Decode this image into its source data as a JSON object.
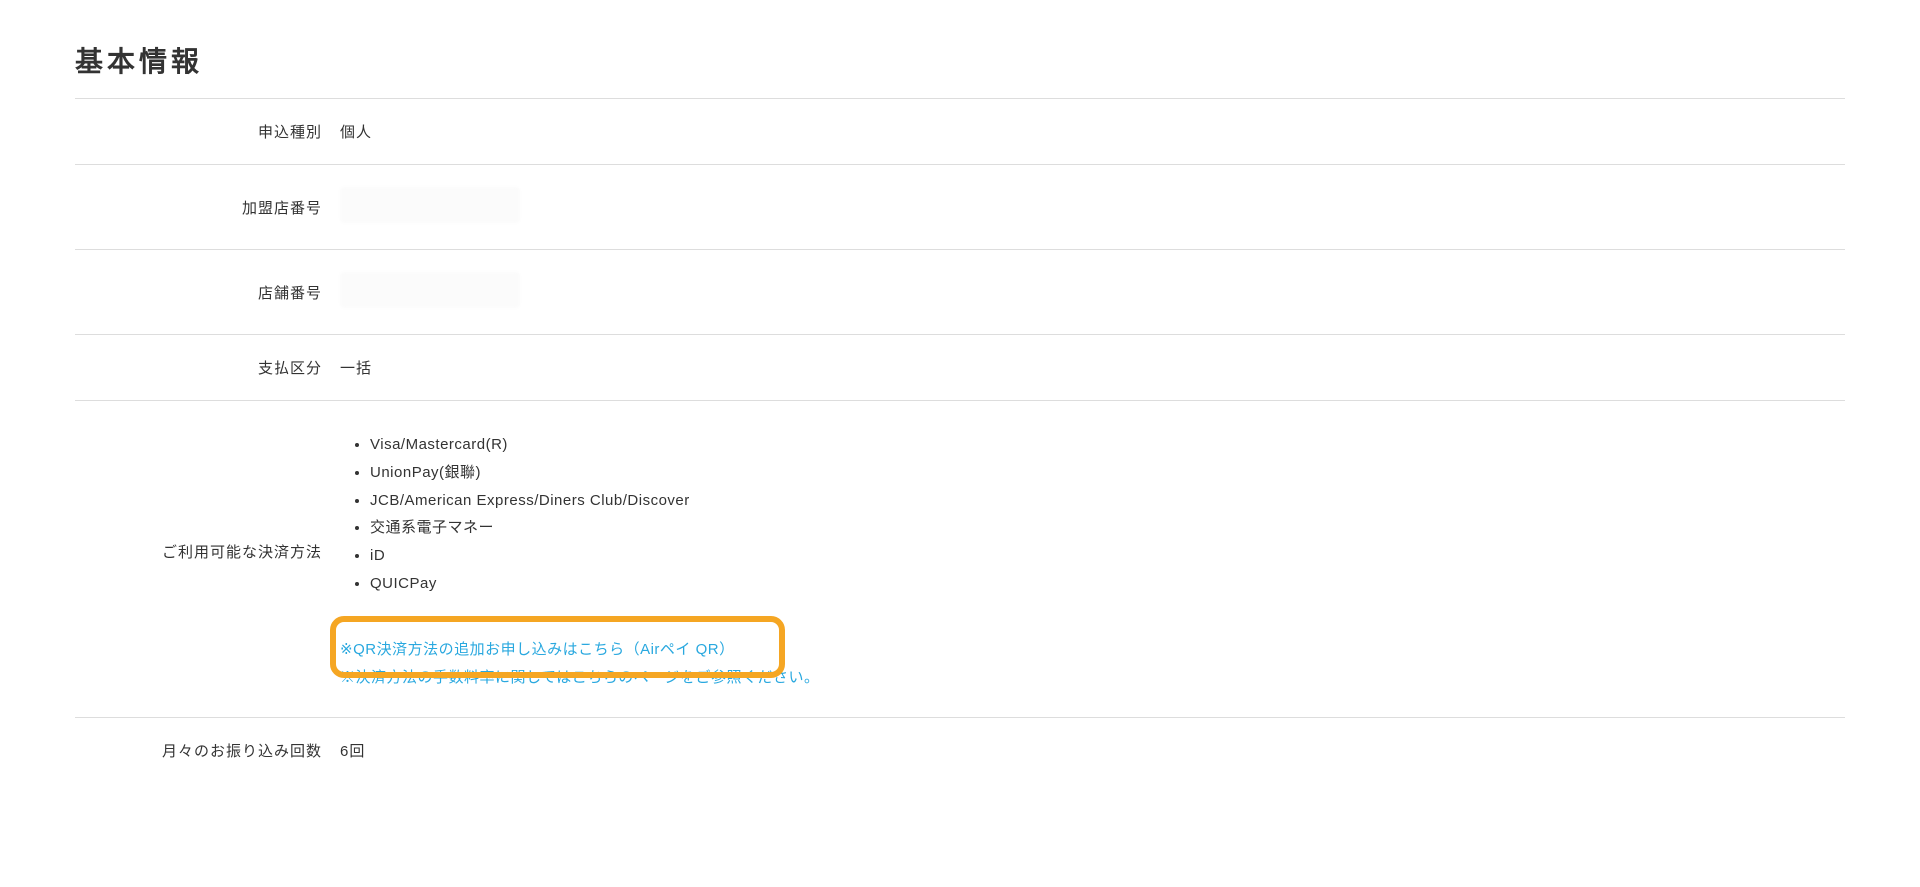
{
  "section": {
    "title": "基本情報"
  },
  "rows": {
    "applicationType": {
      "label": "申込種別",
      "value": "個人"
    },
    "merchantNumber": {
      "label": "加盟店番号",
      "value": ""
    },
    "storeNumber": {
      "label": "店舗番号",
      "value": ""
    },
    "paymentCategory": {
      "label": "支払区分",
      "value": "一括"
    },
    "paymentMethods": {
      "label": "ご利用可能な決済方法",
      "items": [
        "Visa/Mastercard(R)",
        "UnionPay(銀聯)",
        "JCB/American Express/Diners Club/Discover",
        "交通系電子マネー",
        "iD",
        "QUICPay"
      ],
      "links": {
        "qrApplication": "※QR決済方法の追加お申し込みはこちら（Airペイ QR）",
        "feeInfo": "※決済方法の手数料率に関してはこちらのページをご参照ください。"
      }
    },
    "transferCount": {
      "label": "月々のお振り込み回数",
      "value": "6回"
    }
  }
}
